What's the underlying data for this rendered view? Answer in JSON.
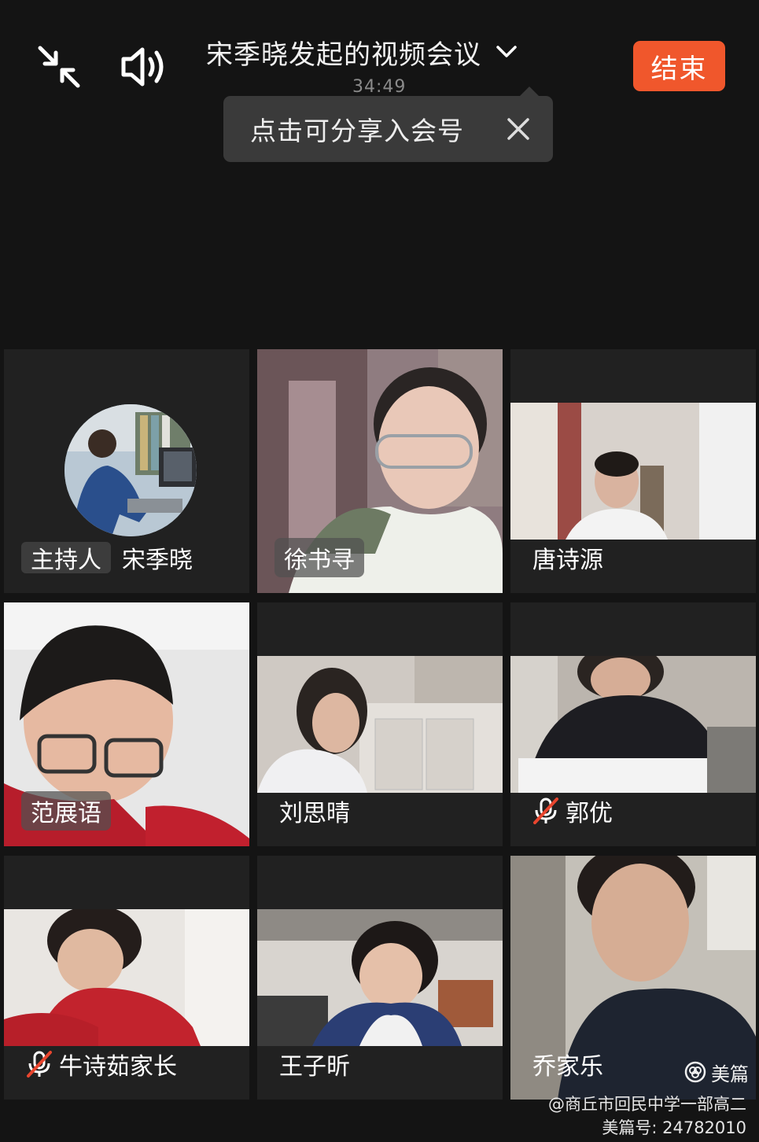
{
  "header": {
    "meeting_title": "宋季晓发起的视频会议",
    "timer": "34:49",
    "end_label": "结束"
  },
  "share_tooltip": {
    "text": "点击可分享入会号"
  },
  "participants": [
    {
      "name": "宋季晓",
      "role_badge": "主持人",
      "muted": false
    },
    {
      "name": "徐书寻",
      "muted": false
    },
    {
      "name": "唐诗源",
      "muted": false
    },
    {
      "name": "范展语",
      "muted": false
    },
    {
      "name": "刘思晴",
      "muted": false
    },
    {
      "name": "郭优",
      "muted": true
    },
    {
      "name": "牛诗茹家长",
      "muted": true
    },
    {
      "name": "王子昕",
      "muted": false
    },
    {
      "name": "乔家乐",
      "muted": false
    }
  ],
  "watermark": {
    "logo_text": "美篇",
    "source": "@商丘市回民中学一部高二",
    "id_text": "美篇号: 24782010"
  },
  "colors": {
    "background": "#141414",
    "tile": "#212121",
    "end_button": "#f0572c",
    "tooltip": "#3a3a3a",
    "mute_red": "#e8452e"
  },
  "icons": [
    "minimize-icon",
    "speaker-icon",
    "chevron-down-icon",
    "close-icon",
    "mic-muted-icon",
    "meipian-logo-icon"
  ]
}
